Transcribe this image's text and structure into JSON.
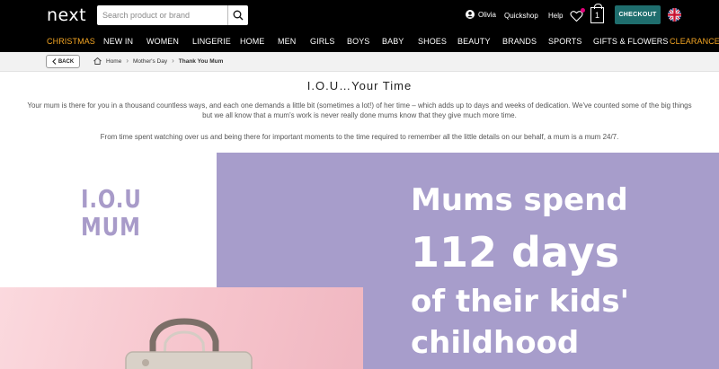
{
  "header": {
    "logo": "next",
    "search_placeholder": "Search product or brand",
    "user_name": "Olivia",
    "quickshop": "Quickshop",
    "help": "Help",
    "bag_count": "1",
    "checkout": "CHECKOUT",
    "icons": [
      "search-icon",
      "user-icon",
      "heart-icon",
      "shopping-bag-icon",
      "uk-flag-icon"
    ]
  },
  "nav": {
    "items": [
      "CHRISTMAS",
      "NEW IN",
      "WOMEN",
      "LINGERIE",
      "HOME",
      "MEN",
      "GIRLS",
      "BOYS",
      "BABY",
      "SHOES",
      "BEAUTY",
      "BRANDS",
      "SPORTS",
      "GIFTS & FLOWERS",
      "CLEARANCE"
    ]
  },
  "breadcrumb": {
    "back": "BACK",
    "home": "Home",
    "mothers_day": "Mother's Day",
    "current": "Thank You Mum"
  },
  "article": {
    "title": "I.O.U…Your Time",
    "para1_line1": "Your mum is there for you in a thousand countless ways, and each one demands a little bit (sometimes a lot!) of her time – which adds up to days and weeks of dedication. We've counted some of the big things",
    "para1_line2": "but we all know that a mum's work is never really done mums know that they give much more time.",
    "para2": "From time spent watching over us and being there for important moments to the time required to remember all the little details on our behalf, a mum is a mum 24/7."
  },
  "hero": {
    "logo_line1": "I.O.U",
    "logo_line2": "MUM",
    "line1": "Mums spend",
    "line2": "112 days",
    "line3": "of their kids'",
    "line4": "childhood"
  },
  "colors": {
    "accent": "#1f6e6e",
    "promo": "#f5a623",
    "lilac": "#a79dcb",
    "pink": "#f6c4cc"
  }
}
